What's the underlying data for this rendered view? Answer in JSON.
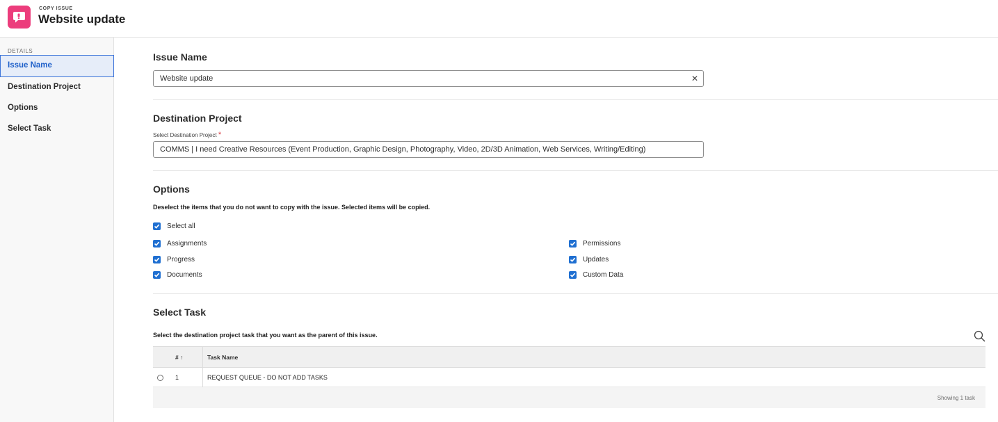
{
  "header": {
    "kicker": "COPY ISSUE",
    "title": "Website update",
    "brand_color": "#ec3d7c"
  },
  "sidebar": {
    "section_label": "DETAILS",
    "items": [
      {
        "label": "Issue Name",
        "active": true
      },
      {
        "label": "Destination Project",
        "active": false
      },
      {
        "label": "Options",
        "active": false
      },
      {
        "label": "Select Task",
        "active": false
      }
    ]
  },
  "issue_name": {
    "heading": "Issue Name",
    "value": "Website update",
    "clear_icon": "close-icon"
  },
  "destination_project": {
    "heading": "Destination Project",
    "field_label": "Select Destination Project",
    "required_mark": "*",
    "value": "COMMS | I need Creative Resources (Event Production, Graphic Design, Photography, Video, 2D/3D Animation, Web Services, Writing/Editing)"
  },
  "options": {
    "heading": "Options",
    "help": "Deselect the items that you do not want to copy with the issue. Selected items will be copied.",
    "select_all": {
      "label": "Select all",
      "checked": true
    },
    "left_column": [
      {
        "label": "Assignments",
        "checked": true
      },
      {
        "label": "Progress",
        "checked": true
      },
      {
        "label": "Documents",
        "checked": true
      }
    ],
    "right_column": [
      {
        "label": "Permissions",
        "checked": true
      },
      {
        "label": "Updates",
        "checked": true
      },
      {
        "label": "Custom Data",
        "checked": true
      }
    ],
    "accent_color": "#1f6fd1"
  },
  "select_task": {
    "heading": "Select Task",
    "help": "Select the destination project task that you want as the parent of this issue.",
    "search_icon": "search-icon",
    "table": {
      "columns": {
        "number": "#",
        "sort_icon": "↑",
        "task_name": "Task Name"
      },
      "rows": [
        {
          "number": "1",
          "task_name": "REQUEST QUEUE - DO NOT ADD TASKS",
          "selected": false
        }
      ],
      "footer": "Showing 1 task"
    }
  }
}
